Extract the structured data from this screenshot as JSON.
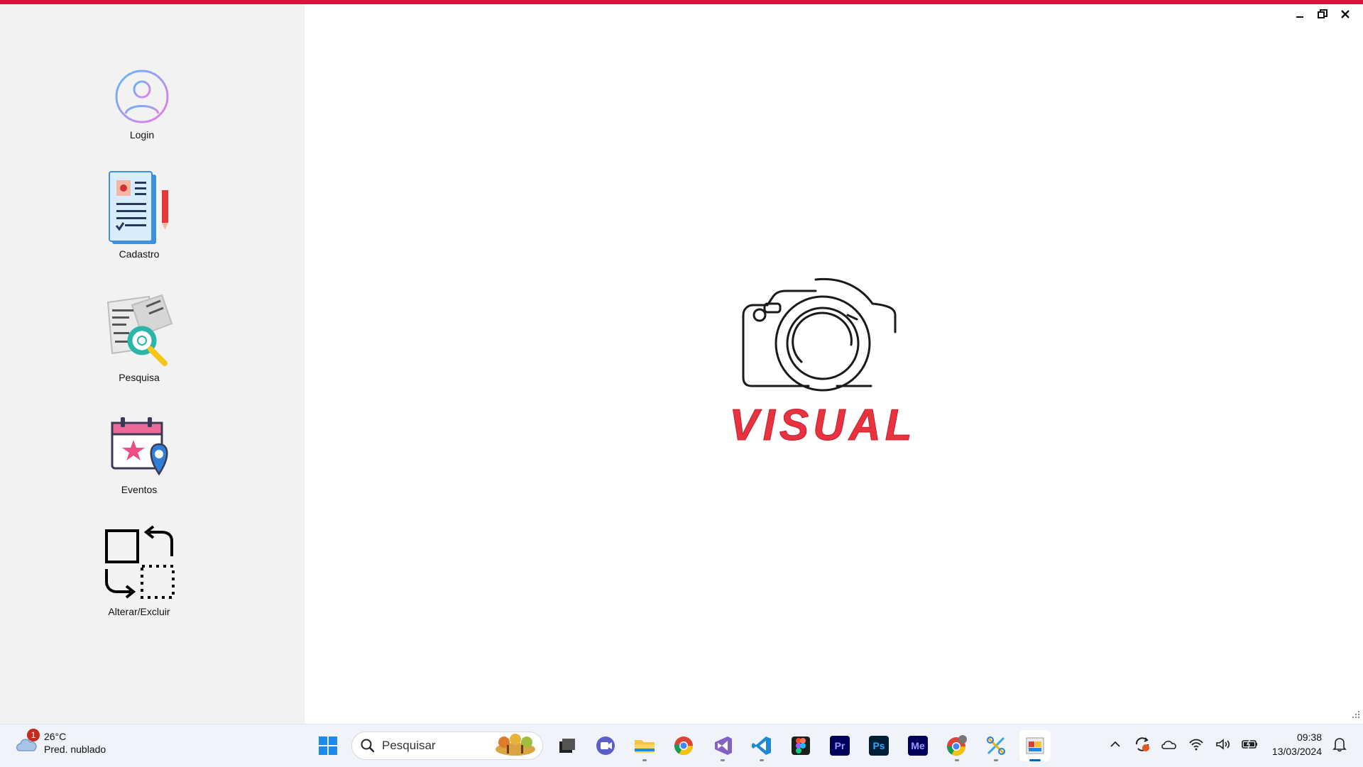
{
  "window": {
    "accent_color": "#d4163c",
    "controls": [
      "minimize-icon",
      "restore-icon",
      "close-icon"
    ]
  },
  "sidebar": {
    "items": [
      {
        "label": "Login",
        "icon": "user-circle-icon"
      },
      {
        "label": "Cadastro",
        "icon": "registration-form-icon"
      },
      {
        "label": "Pesquisa",
        "icon": "document-search-icon"
      },
      {
        "label": "Eventos",
        "icon": "calendar-location-icon"
      },
      {
        "label": "Alterar/Excluir",
        "icon": "swap-edit-icon"
      }
    ]
  },
  "main": {
    "logo_text": "VISUAL",
    "logo_icon": "camera-outline-icon",
    "logo_color": "#e8323f"
  },
  "taskbar": {
    "weather": {
      "temp": "26°C",
      "desc": "Pred. nublado",
      "badge": "1"
    },
    "search_placeholder": "Pesquisar",
    "apps": [
      "windows-start-icon",
      "file-manager-icon",
      "meet-icon",
      "folder-icon",
      "chrome-icon",
      "visual-studio-icon",
      "vscode-icon",
      "figma-icon",
      "premiere-icon",
      "photoshop-icon",
      "media-encoder-icon",
      "chrome-profile-icon",
      "snipping-icon",
      "app-window-icon"
    ],
    "app_labels": {
      "premiere": "Pr",
      "photoshop": "Ps",
      "media_encoder": "Me"
    },
    "clock": {
      "time": "09:38",
      "date": "13/03/2024"
    }
  }
}
